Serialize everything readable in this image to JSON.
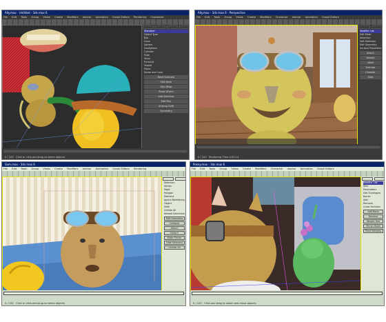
{
  "panels": [
    {
      "id": "top-left",
      "theme": "dark",
      "title": "Ally.max - Untitled - 3ds max 6",
      "menus": [
        "File",
        "Edit",
        "Tools",
        "Group",
        "Views",
        "Create",
        "Modifiers",
        "reactor",
        "Animation",
        "Graph Editors",
        "Rendering",
        "Customize",
        "MAXScript",
        "Help"
      ],
      "command_panel": {
        "rows": [
          "Standard",
          "Object Type",
          "Box",
          "Cone",
          "Sphere",
          "GeoSphere",
          "Cylinder",
          "Tube",
          "Torus",
          "Pyramid",
          "Teapot",
          "Plane",
          "Name and Color"
        ],
        "buttons": [
          "Bend Selected",
          "Edit Mesh",
          "Skin Wrap",
          "Reset XForm",
          "Soft Selection",
          "Edit Poly",
          "Unwrap UVW",
          "Symmetry"
        ]
      },
      "status": "0 / 100",
      "frame": "Click or click-and-drag to select objects"
    },
    {
      "id": "top-right",
      "theme": "dark",
      "title": "Ally.max - 3ds max 6 - Perspective",
      "menus": [
        "File",
        "Edit",
        "Tools",
        "Group",
        "Views",
        "Create",
        "Modifiers",
        "Character",
        "reactor",
        "Animation",
        "Graph Editors",
        "Rendering",
        "Customize",
        "MAXScript",
        "Help"
      ],
      "command_panel": {
        "rows": [
          "Modifier List",
          "Edit Mesh",
          "Selection",
          "Soft Selection",
          "Edit Geometry",
          "Surface Properties"
        ],
        "buttons": [
          "Attach",
          "Detach",
          "Weld",
          "Extrude",
          "Chamfer",
          "Slice"
        ]
      },
      "status": "0 / 100",
      "frame": "Rendering Time 0:00:14"
    },
    {
      "id": "bottom-left",
      "theme": "light",
      "title": "Sam.max - 3ds max 6",
      "menus": [
        "File",
        "Edit",
        "Tools",
        "Group",
        "Views",
        "Create",
        "Modifiers",
        "reactor",
        "Animation",
        "Graph Editors",
        "Rendering",
        "Customize",
        "MAXScript",
        "Help"
      ],
      "command_panel": {
        "rows": [
          "Selection",
          "Vertex",
          "Edge",
          "Polygon",
          "Element",
          "Ignore Backfacing",
          "Object",
          "Hide",
          "Unhide All",
          "Named Selections"
        ],
        "buttons": [
          "Edit Geometry",
          "Collapse",
          "Attach",
          "Detach",
          "Make Planar",
          "Hide Selected",
          "Unhide All"
        ]
      },
      "status": "0 / 100",
      "frame": "Click or click-and-drag to select objects"
    },
    {
      "id": "bottom-right",
      "theme": "light",
      "title": "Pokey.max - 3ds max 6",
      "menus": [
        "File",
        "Edit",
        "Tools",
        "Group",
        "Views",
        "Create",
        "Modifiers",
        "Character",
        "reactor",
        "Animation",
        "Graph Editors",
        "Rendering",
        "Customize",
        "MAXScript",
        "Help"
      ],
      "command_panel": {
        "rows": [
          "Modifier List",
          "Skin",
          "Parameters",
          "Edit Envelopes",
          "Bones",
          "Add",
          "Remove",
          "Cross Sections"
        ],
        "buttons": [
          "Add Bone",
          "Remove",
          "Weight Tool",
          "Mirror Mode",
          "Paint Weights"
        ]
      },
      "status": "0 / 100",
      "frame": "Click and drag to select and move objects"
    }
  ],
  "colors": {
    "dark_chrome": "#4a4a4a",
    "dark_panel": "#3c3c3c",
    "light_chrome": "#d6dfd0",
    "light_panel": "#dfe6d6",
    "title_blue": "#0a246a",
    "viewport_border": "#e8e800"
  }
}
